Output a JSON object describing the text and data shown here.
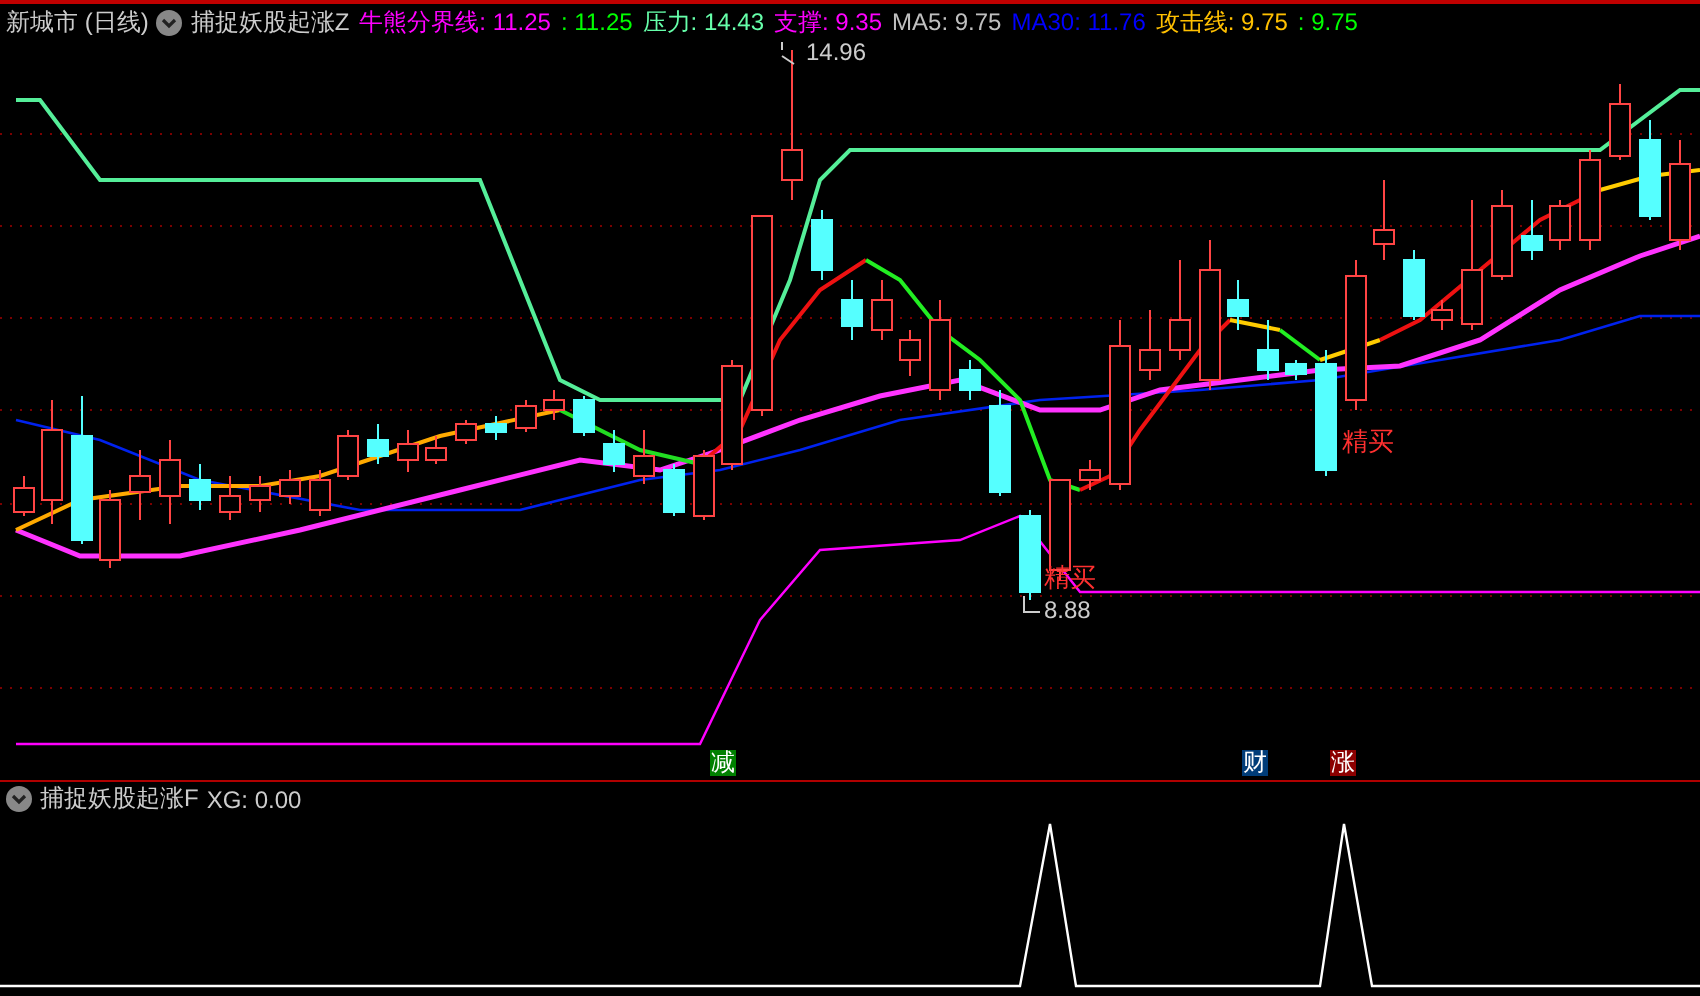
{
  "main_panel": {
    "title": "新城市 (日线)",
    "indicator": "捕捉妖股起涨Z",
    "legend": [
      {
        "text": "牛熊分界线: 11.25",
        "color": "#ff00ff"
      },
      {
        "text": ": 11.25",
        "color": "#00ff00"
      },
      {
        "text": "压力: 14.43",
        "color": "#66ffaa"
      },
      {
        "text": "支撑: 9.35",
        "color": "#ff00ff"
      },
      {
        "text": "MA5: 9.75",
        "color": "#c0c0c0"
      },
      {
        "text": "MA30: 11.76",
        "color": "#0000ff"
      },
      {
        "text": "攻击线: 9.75",
        "color": "#ffc000"
      },
      {
        "text": ": 9.75",
        "color": "#00ff00"
      }
    ],
    "annotations": [
      {
        "kind": "high",
        "text": "14.96"
      },
      {
        "kind": "low",
        "text": "8.88"
      },
      {
        "kind": "buy",
        "text": "精买"
      },
      {
        "kind": "buy",
        "text": "精买"
      }
    ],
    "signals": [
      {
        "text": "减",
        "color": "#008000"
      },
      {
        "text": "财",
        "color": "#003c78"
      },
      {
        "text": "涨",
        "color": "#8c0000"
      }
    ]
  },
  "sub_panel": {
    "indicator": "捕捉妖股起涨F",
    "reading": "XG: 0.00"
  }
}
